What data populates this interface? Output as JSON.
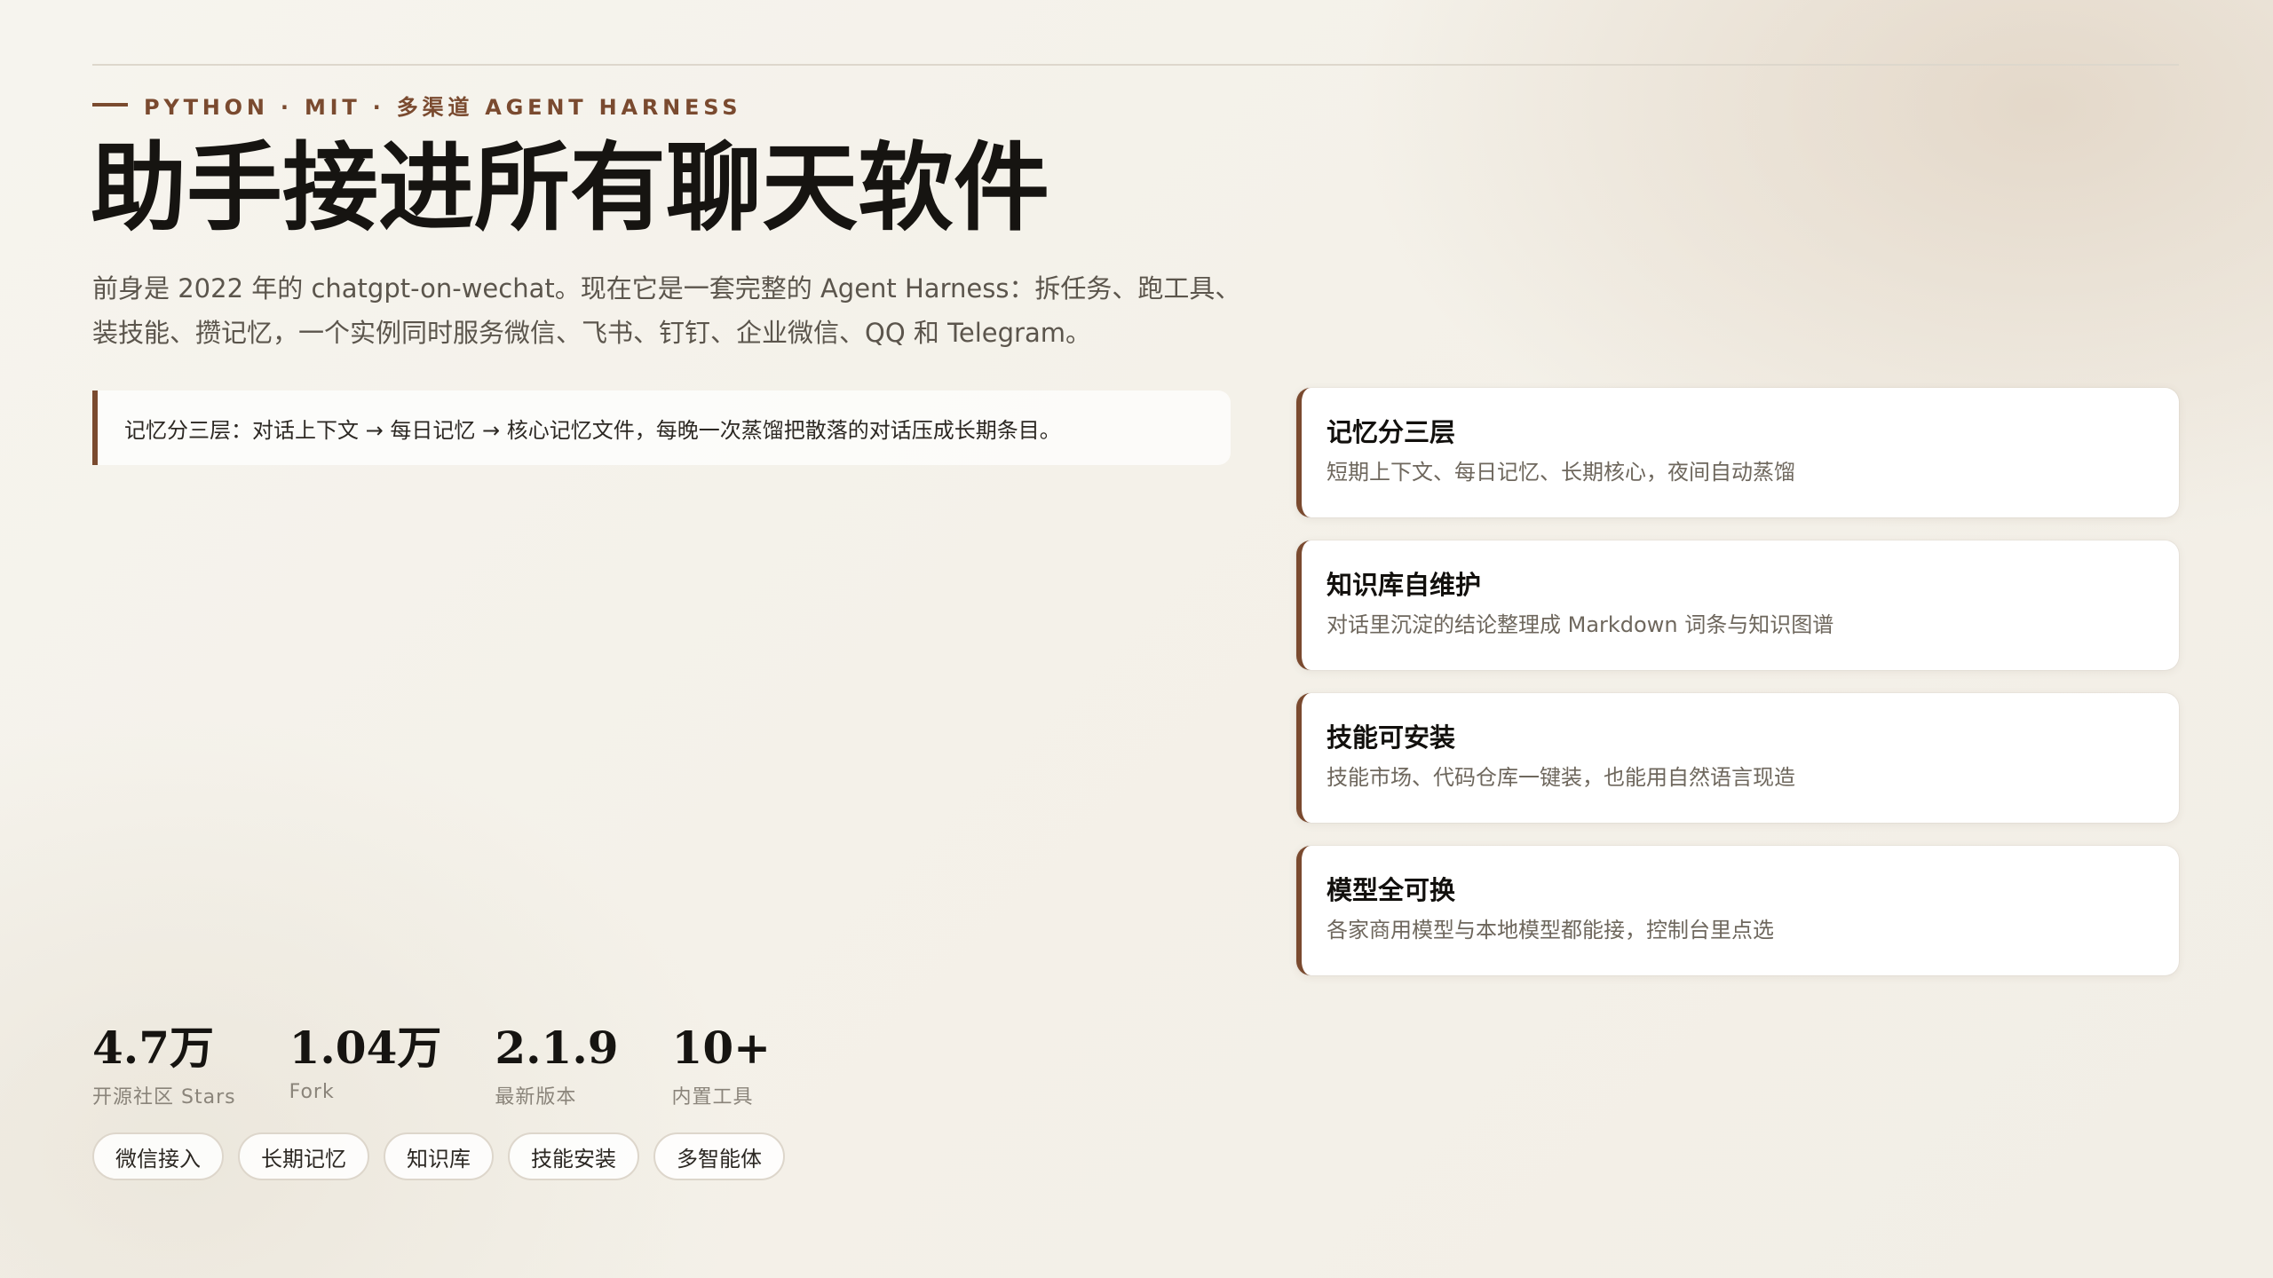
{
  "header": {
    "eyebrow": "PYTHON · MIT · 多渠道 AGENT HARNESS",
    "title": "助手接进所有聊天软件",
    "lede_line1": "前身是 2022 年的 chatgpt-on-wechat。现在它是一套完整的 Agent Harness：拆任务、跑工具、",
    "lede_line2": "装技能、攒记忆，一个实例同时服务微信、飞书、钉钉、企业微信、QQ 和 Telegram。"
  },
  "callout": {
    "text": "记忆分三层：对话上下文 → 每日记忆 → 核心记忆文件，每晚一次蒸馏把散落的对话压成长期条目。"
  },
  "features": [
    {
      "title": "记忆分三层",
      "desc": "短期上下文、每日记忆、长期核心，夜间自动蒸馏"
    },
    {
      "title": "知识库自维护",
      "desc": "对话里沉淀的结论整理成 Markdown 词条与知识图谱"
    },
    {
      "title": "技能可安装",
      "desc": "技能市场、代码仓库一键装，也能用自然语言现造"
    },
    {
      "title": "模型全可换",
      "desc": "各家商用模型与本地模型都能接，控制台里点选"
    }
  ],
  "stats": [
    {
      "value": "4.7万",
      "label": "开源社区 Stars"
    },
    {
      "value": "1.04万",
      "label": "Fork"
    },
    {
      "value": "2.1.9",
      "label": "最新版本"
    },
    {
      "value": "10+",
      "label": "内置工具"
    }
  ],
  "tags": [
    "微信接入",
    "长期记忆",
    "知识库",
    "技能安装",
    "多智能体"
  ],
  "colors": {
    "accent": "#7a4a2f",
    "background": "#f5f2eb",
    "card": "#ffffff"
  }
}
